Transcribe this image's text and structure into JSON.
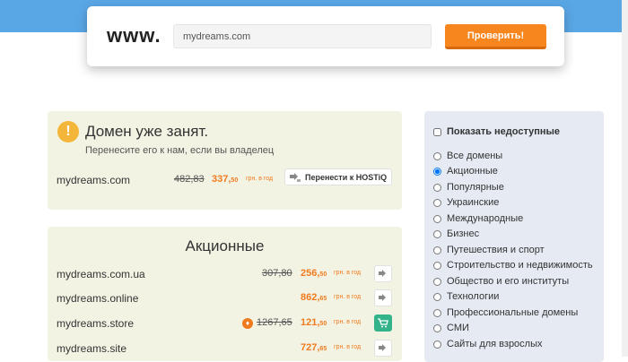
{
  "header": {
    "prefix": "www.",
    "search_value": "mydreams.com",
    "check_button": "Проверить!"
  },
  "taken": {
    "title": "Домен уже занят.",
    "subtitle": "Перенесите его к нам, если вы владелец",
    "domain": "mydreams.com",
    "old_price": "482,83",
    "price_main": "337,",
    "price_cents": "50",
    "per": "грн. в год",
    "transfer_button": "Перенести к HOSTiQ"
  },
  "promo": {
    "title": "Акционные",
    "rows": [
      {
        "domain": "mydreams.com.ua",
        "old_price": "307,80",
        "price_main": "256,",
        "price_cents": "50",
        "per": "грн. в год"
      },
      {
        "domain": "mydreams.online",
        "old_price": "",
        "price_main": "862,",
        "price_cents": "65",
        "per": "грн. в год"
      },
      {
        "domain": "mydreams.store",
        "old_price": "1267,65",
        "price_main": "121,",
        "price_cents": "50",
        "per": "грн. в год"
      },
      {
        "domain": "mydreams.site",
        "old_price": "",
        "price_main": "727,",
        "price_cents": "65",
        "per": "грн. в год"
      }
    ]
  },
  "filter": {
    "show_unavailable": "Показать недоступные",
    "options": [
      "Все домены",
      "Акционные",
      "Популярные",
      "Украинские",
      "Международные",
      "Бизнес",
      "Путешествия и спорт",
      "Строительство и недвижимость",
      "Общество и его институты",
      "Технологии",
      "Профессиональные домены",
      "СМИ",
      "Сайты для взрослых"
    ],
    "selected_index": 1
  },
  "colors": {
    "accent": "#f7861f",
    "price": "#f07b1e",
    "panel": "#f3f3e4",
    "filter_bg": "#e6ebf3",
    "header_band": "#5aa7e6"
  }
}
